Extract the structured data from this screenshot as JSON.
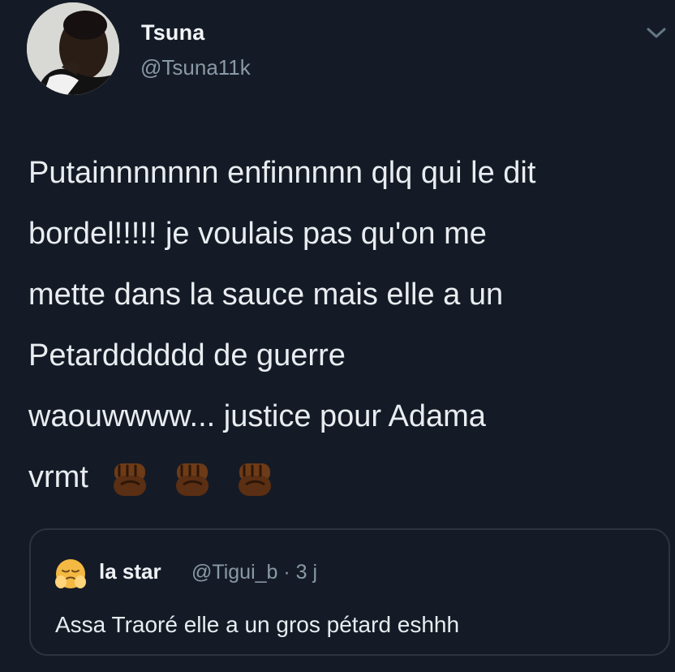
{
  "author": {
    "display_name": "Tsuna",
    "handle": "@Tsuna11k"
  },
  "tweet": {
    "lines": [
      "Putainnnnnnn enfinnnnn qlq qui le dit",
      "bordel!!!!! je voulais pas qu'on me",
      "mette dans la sauce mais elle a un",
      "Petardddddd de guerre",
      "waouwwww... justice pour Adama",
      "vrmt"
    ],
    "emojis": [
      "raised-fist-dark-skin",
      "raised-fist-dark-skin",
      "raised-fist-dark-skin"
    ]
  },
  "quoted_tweet": {
    "emoji": "pensive-face-hands-emoji",
    "display_name": "la star",
    "meta": "@Tigui_b · 3 j",
    "text": "Assa Traoré elle a un gros pétard eshhh"
  },
  "icons": {
    "menu": "chevron-down-icon"
  },
  "colors": {
    "background": "#151b26",
    "primary_text": "#e7ecf0",
    "secondary_text": "#8899a6",
    "border": "#2c3440"
  }
}
